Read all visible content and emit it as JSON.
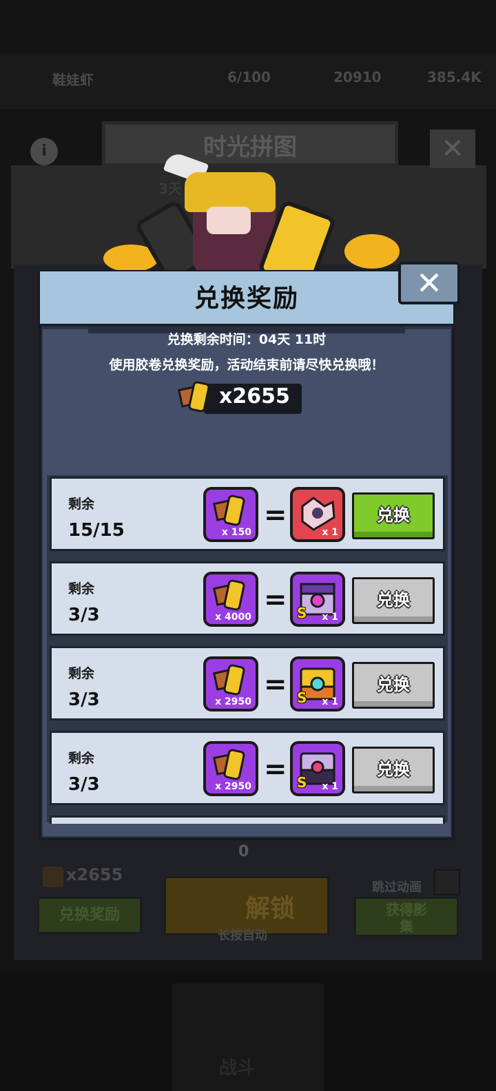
{
  "background": {
    "player_name": "鞋娃虾",
    "stamina": "6/100",
    "gems": "20910",
    "gold": "385.4K",
    "page_title": "时光拼图",
    "timer": "3天 11时",
    "film_count": "x2655",
    "exchange_button": "兑换奖励",
    "unlock_counter": "0",
    "unlock_button": "解锁",
    "unlock_hint": "长按自动",
    "skip_animation": "跳过动画",
    "obtain_album": "获得影集",
    "nav_battle": "战斗"
  },
  "dialog": {
    "title": "兑换奖励",
    "remaining_time": "兑换剩余时间：04天 11时",
    "tip": "使用胶卷兑换奖励，活动结束前请尽快兑换哦！",
    "token_count": "x2655",
    "close_icon": "close-icon"
  },
  "rewards": [
    {
      "label": "剩余",
      "remaining": "15/15",
      "cost": "x 150",
      "reward_qty": "x 1",
      "reward_type": "puzzle-piece-icon",
      "button": "兑换",
      "enabled": true
    },
    {
      "label": "剩余",
      "remaining": "3/3",
      "cost": "x 4000",
      "reward_qty": "x 1",
      "reward_type": "s-rank-chest-icon",
      "button": "兑换",
      "enabled": false
    },
    {
      "label": "剩余",
      "remaining": "3/3",
      "cost": "x 2950",
      "reward_qty": "x 1",
      "reward_type": "s-rank-gold-chest-icon",
      "button": "兑换",
      "enabled": false
    },
    {
      "label": "剩余",
      "remaining": "3/3",
      "cost": "x 2950",
      "reward_qty": "x 1",
      "reward_type": "s-rank-dark-chest-icon",
      "button": "兑换",
      "enabled": false
    }
  ],
  "colors": {
    "header": "#a7c6dd",
    "panel": "#44506a",
    "row": "#d6deeb",
    "cost_tile": "#9a3ee3",
    "button_active": "#7ecb2b",
    "button_disabled": "#c7c7c7"
  }
}
